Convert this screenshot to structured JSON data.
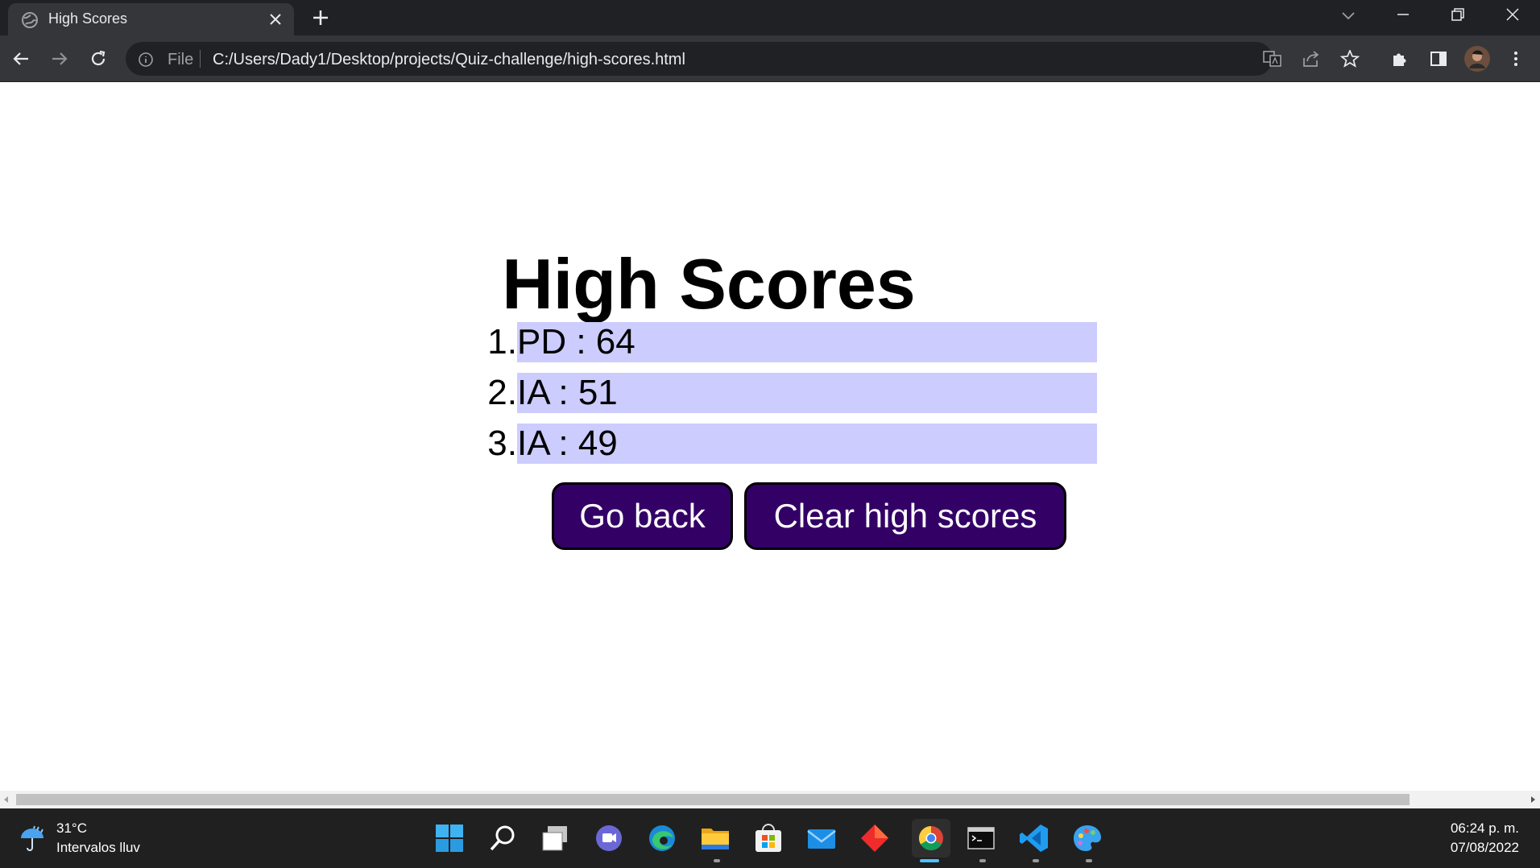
{
  "browser": {
    "tab_title": "High Scores",
    "omnibox_scheme": "File",
    "url": "C:/Users/Dady1/Desktop/projects/Quiz-challenge/high-scores.html"
  },
  "page": {
    "heading": "High Scores",
    "scores": [
      {
        "rank": "1.",
        "text": "PD : 64"
      },
      {
        "rank": "2.",
        "text": "IA : 51"
      },
      {
        "rank": "3.",
        "text": "IA : 49"
      }
    ],
    "go_back_label": "Go back",
    "clear_label": "Clear high scores",
    "colors": {
      "row_bg": "#ccccff",
      "button_bg": "#330066"
    }
  },
  "taskbar": {
    "weather_temp": "31°C",
    "weather_desc": "Intervalos lluv",
    "time": "06:24 p. m.",
    "date": "07/08/2022",
    "apps": [
      "start-icon",
      "search-icon",
      "task-view-icon",
      "chat-icon",
      "edge-icon",
      "file-explorer-icon",
      "store-icon",
      "mail-icon",
      "git-app-icon",
      "chrome-icon",
      "terminal-icon",
      "vscode-icon",
      "paint-icon"
    ]
  }
}
